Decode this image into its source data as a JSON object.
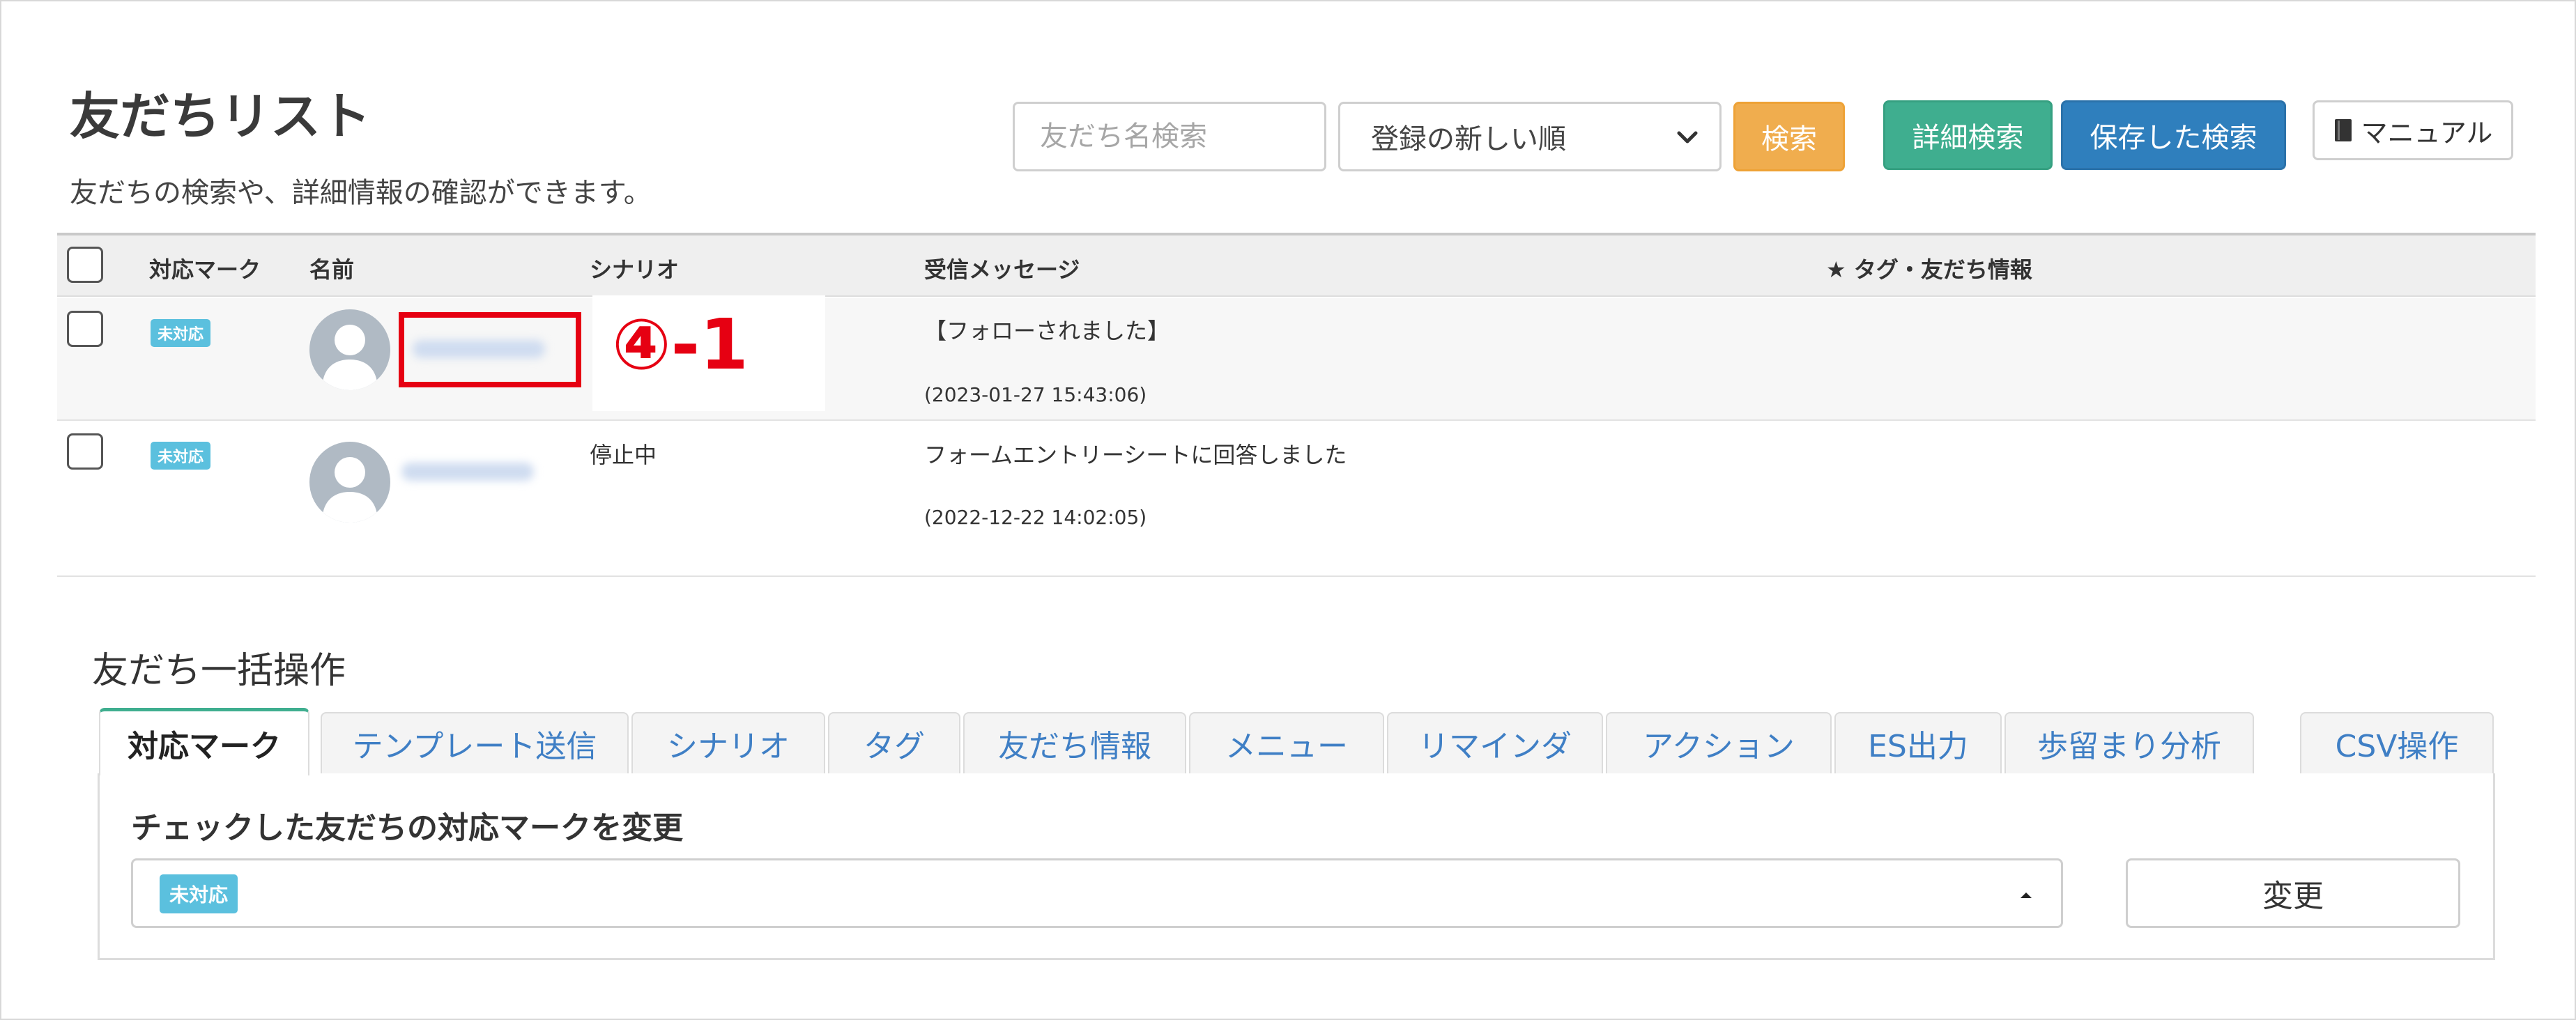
{
  "header": {
    "title": "友だちリスト",
    "subtitle": "友だちの検索や、詳細情報の確認ができます。",
    "search_placeholder": "友だち名検索",
    "sort_selected": "登録の新しい順",
    "search_button": "検索",
    "advanced_search_button": "詳細検索",
    "saved_search_button": "保存した検索",
    "manual_button": "マニュアル"
  },
  "table": {
    "columns": [
      "対応マーク",
      "名前",
      "シナリオ",
      "受信メッセージ",
      "★ タグ・友だち情報"
    ],
    "rows": [
      {
        "badge": "未対応",
        "scenario": "",
        "message": "【フォローされました】",
        "timestamp": "(2023-01-27 15:43:06)"
      },
      {
        "badge": "未対応",
        "scenario": "停止中",
        "message": "フォームエントリーシートに回答しました",
        "timestamp": "(2022-12-22 14:02:05)"
      }
    ]
  },
  "annotation": {
    "label": "④-1",
    "color": "#e60012"
  },
  "bulk": {
    "title": "友だち一括操作",
    "tabs": [
      "対応マーク",
      "テンプレート送信",
      "シナリオ",
      "タグ",
      "友だち情報",
      "メニュー",
      "リマインダ",
      "アクション",
      "ES出力",
      "歩留まり分析",
      "CSV操作"
    ],
    "active_tab": "対応マーク",
    "panel_heading": "チェックした友だちの対応マークを変更",
    "selected_mark": "未対応",
    "change_button": "変更"
  },
  "colors": {
    "badge": "#5bc0de",
    "search_button": "#f0ad4e",
    "advanced_search_button": "#3fae8f",
    "saved_search_button": "#2f7fbd",
    "tab_text": "#3f7fc5"
  },
  "icons": [
    "chevron-down-icon",
    "book-icon",
    "user-avatar-icon",
    "caret-up-icon"
  ]
}
